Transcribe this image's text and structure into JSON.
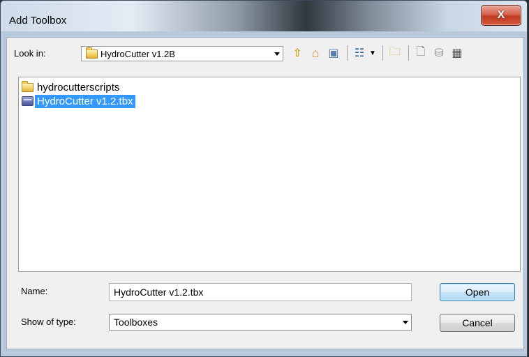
{
  "window": {
    "title": "Add Toolbox",
    "close_glyph": "X"
  },
  "lookin": {
    "label": "Look in:",
    "value": "HydroCutter v1.2B",
    "icon": "folder-icon"
  },
  "toolbar": {
    "buttons": [
      {
        "name": "up-one-level-icon",
        "glyph": "⇧"
      },
      {
        "name": "home-folder-icon",
        "glyph": "⌂"
      },
      {
        "name": "connect-folder-icon",
        "glyph": "▣"
      },
      {
        "name": "view-details-icon",
        "glyph": "☷"
      },
      {
        "name": "new-folder-icon",
        "glyph": "🗀"
      },
      {
        "name": "new-file-icon",
        "glyph": "🗋"
      },
      {
        "name": "new-database-icon",
        "glyph": "⛁"
      },
      {
        "name": "new-toolbox-icon",
        "glyph": "▦"
      }
    ]
  },
  "files": [
    {
      "label": "hydrocutterscripts",
      "icon": "folder-icon",
      "selected": false
    },
    {
      "label": "HydroCutter v1.2.tbx",
      "icon": "toolbox-icon",
      "selected": true
    }
  ],
  "name_field": {
    "label": "Name:",
    "value": "HydroCutter v1.2.tbx"
  },
  "type_field": {
    "label": "Show of type:",
    "value": "Toolboxes"
  },
  "buttons": {
    "open": "Open",
    "cancel": "Cancel"
  },
  "colors": {
    "selection": "#3399ff",
    "titlebar_accent": "#303840",
    "close_button": "#c03a22"
  }
}
